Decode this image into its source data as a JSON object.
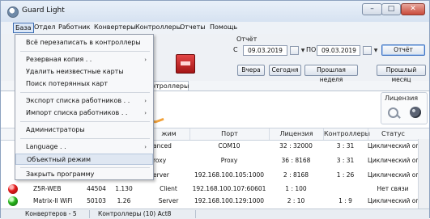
{
  "window": {
    "title": "Guard Light",
    "controls": {
      "minimize": "–",
      "maximize": "□",
      "close": "✕"
    }
  },
  "menubar": [
    "База",
    "Отдел",
    "Работник",
    "Конвертеры",
    "Контроллеры",
    "Отчеты",
    "Помощь"
  ],
  "dropdown": {
    "items": [
      "Всё перезаписать в контроллеры",
      "Резервная копия . .",
      "Удалить неизвестные карты",
      "Поиск потерянных карт",
      "Экспорт списка работников . .",
      "Импорт списка работников . .",
      "Администраторы",
      "Language . .",
      "Объектный режим",
      "Закрыть программу"
    ],
    "submenu_arrow": "›",
    "highlighted_index": 8
  },
  "report": {
    "label": "Отчёт",
    "from_label": "С",
    "to_label": "ПО",
    "from_date": "09.03.2019",
    "to_date": "09.03.2019",
    "report_button": "Отчёт",
    "btn_yesterday": "Вчера",
    "btn_today": "Сегодня",
    "btn_last_week": "Прошлая неделя",
    "btn_last_month": "Прошлый месяц"
  },
  "tabs": [
    "онтроллеры"
  ],
  "license_group": {
    "title": "Лицензия"
  },
  "table": {
    "headers": [
      "жим",
      "Порт",
      "Лицензия",
      "Контроллеры",
      "Статус"
    ],
    "rows": [
      {
        "name": "",
        "port": "",
        "ver": "",
        "mode": "anced",
        "addr": "COM10",
        "license": "32 : 32000",
        "controllers": "3 : 31",
        "status": "Циклический опрос",
        "dot": ""
      },
      {
        "name": "",
        "port": "",
        "ver": "",
        "mode": "roxy",
        "addr": "Proxy",
        "license": "36 : 8168",
        "controllers": "3 : 31",
        "status": "Циклический опрос",
        "dot": ""
      },
      {
        "name": "",
        "port": "",
        "ver": "",
        "mode": "erver",
        "addr": "192.168.100.105:1000",
        "license": "2 : 8168",
        "controllers": "1 : 26",
        "status": "Циклический опрос",
        "dot": ""
      },
      {
        "name": "Z5R-WEB",
        "port": "44504",
        "ver": "1.130",
        "mode": "Client",
        "addr": "192.168.100.107:60601",
        "license": "1 : 100",
        "controllers": "",
        "status": "Нет связи",
        "dot": "red"
      },
      {
        "name": "Matrix-II WiFi",
        "port": "50103",
        "ver": "1.26",
        "mode": "Server",
        "addr": "192.168.100.129:1000",
        "license": "2 : 10",
        "controllers": "1 : 9",
        "status": "Циклический опрос",
        "dot": "green"
      }
    ]
  },
  "statusbar": {
    "converters": "Конвертеров - 5",
    "controllers": "Контроллеры (10) Act8"
  },
  "colors": {
    "accent": "#3b6cb3",
    "titlebar": "#dce6f3",
    "close": "#c94a3b"
  }
}
